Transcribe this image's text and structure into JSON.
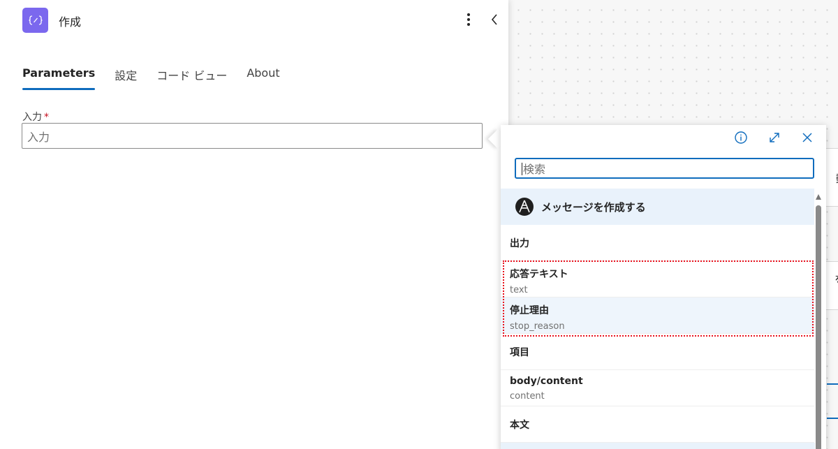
{
  "header": {
    "title": "作成",
    "icon": "curly-braces-icon"
  },
  "tabs": [
    {
      "label": "Parameters",
      "active": true
    },
    {
      "label": "設定",
      "active": false
    },
    {
      "label": "コード ビュー",
      "active": false
    },
    {
      "label": "About",
      "active": false
    }
  ],
  "input_field": {
    "label": "入力",
    "required_mark": "*",
    "placeholder": "入力"
  },
  "canvas_cards": {
    "partial_text_1": "動て",
    "partial_text_2": "を作"
  },
  "popover": {
    "search_placeholder": "検索",
    "group_title": "メッセージを作成する",
    "sections": [
      {
        "title": "出力",
        "items": [
          {
            "name": "応答テキスト",
            "token": "text"
          },
          {
            "name": "停止理由",
            "token": "stop_reason"
          }
        ]
      },
      {
        "title": "項目",
        "items": [
          {
            "name": "body/content",
            "token": "content"
          }
        ]
      },
      {
        "title": "本文",
        "items": []
      }
    ]
  },
  "colors": {
    "accent": "#0f6cbd",
    "app_icon": "#7b68ee",
    "highlight_border": "#e8101c",
    "required": "#c50f1f"
  }
}
